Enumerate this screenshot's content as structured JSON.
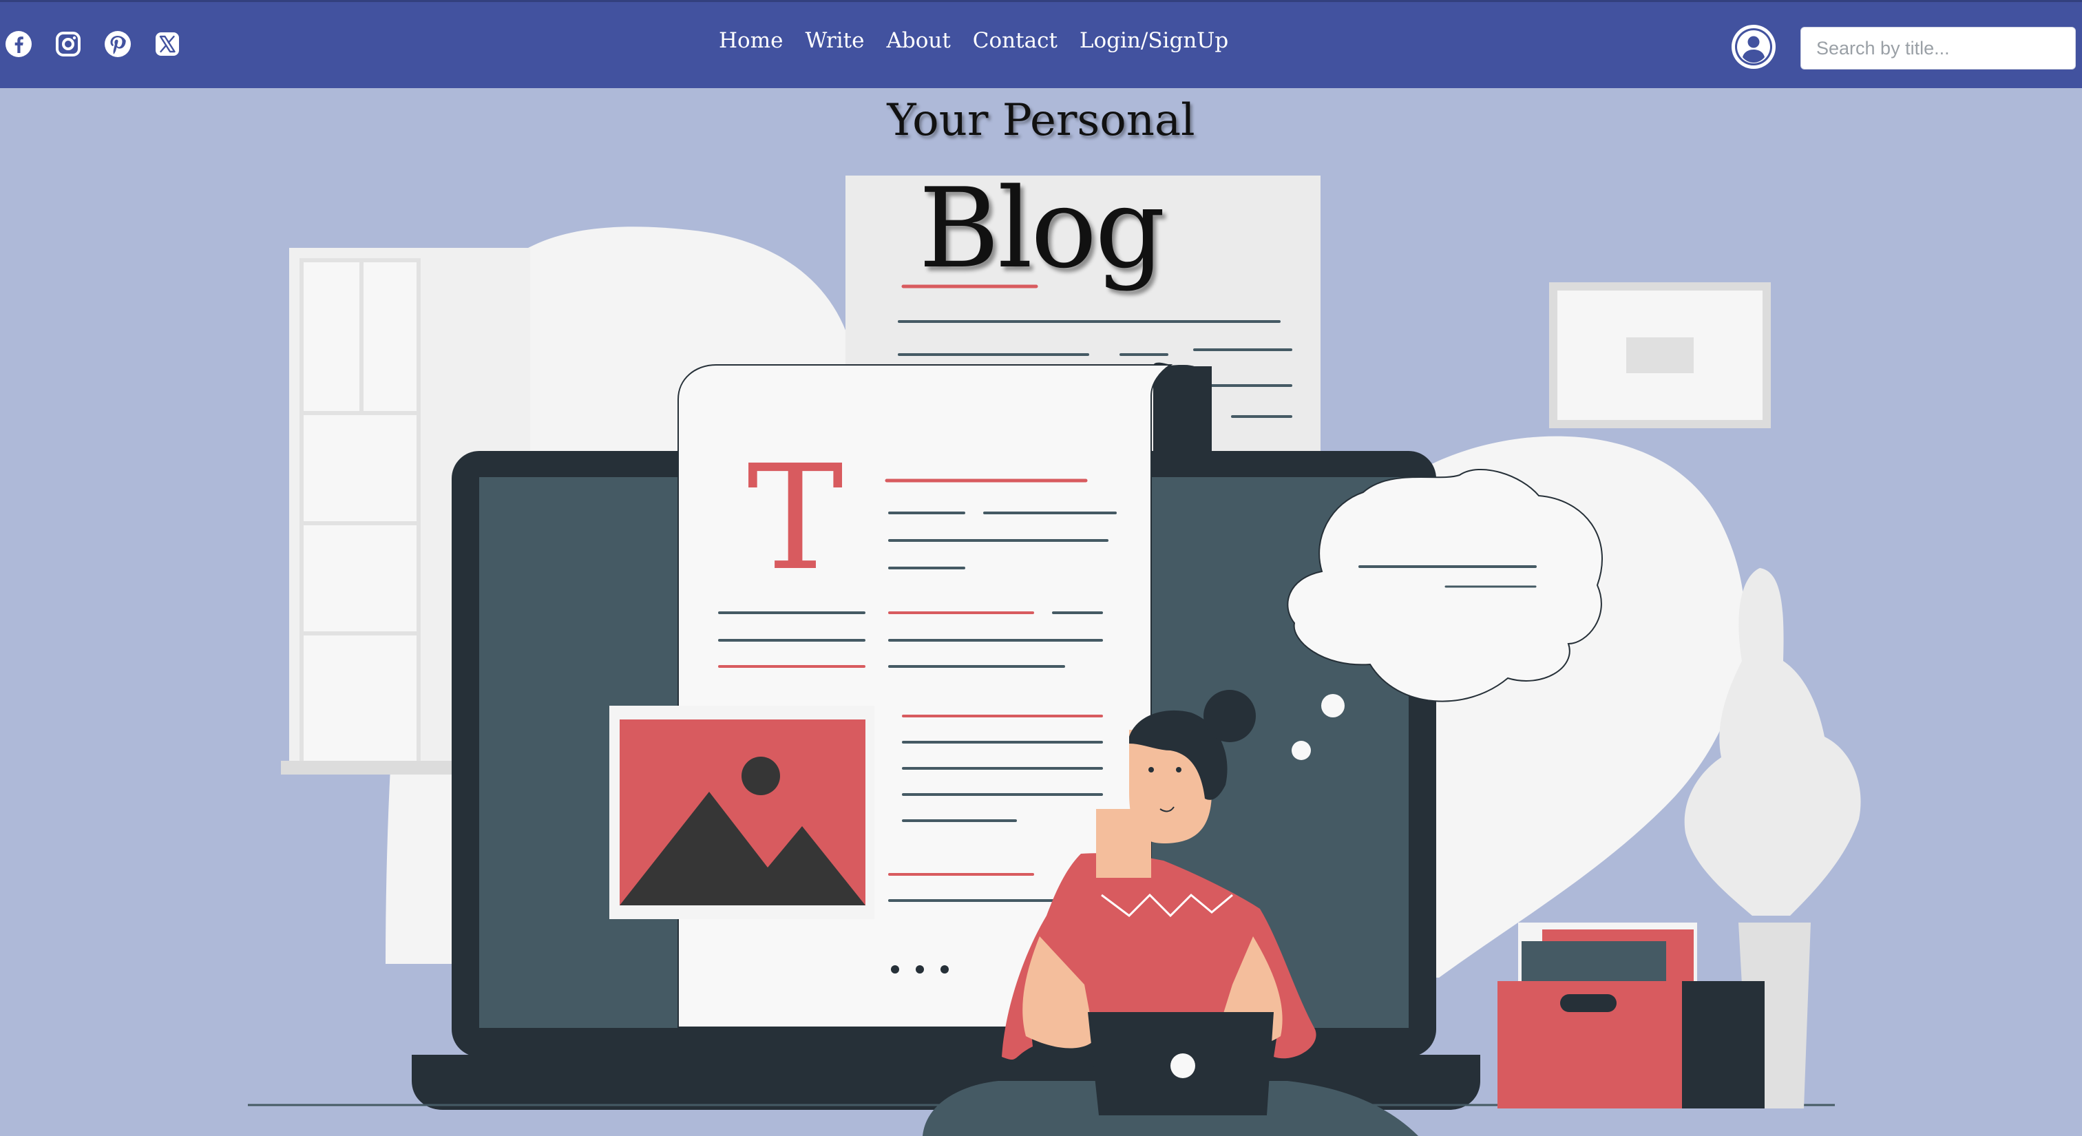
{
  "social": [
    {
      "name": "facebook-icon"
    },
    {
      "name": "instagram-icon"
    },
    {
      "name": "pinterest-icon"
    },
    {
      "name": "x-icon"
    }
  ],
  "nav": {
    "home": "Home",
    "write": "Write",
    "about": "About",
    "contact": "Contact",
    "login": "Login/SignUp"
  },
  "search": {
    "placeholder": "Search by title..."
  },
  "hero": {
    "subtitle": "Your Personal",
    "title": "Blog",
    "letter": "T"
  },
  "colors": {
    "navbar": "#42529f",
    "background": "#aeb9d8",
    "accent": "#d85b5f",
    "dark": "#263038"
  }
}
